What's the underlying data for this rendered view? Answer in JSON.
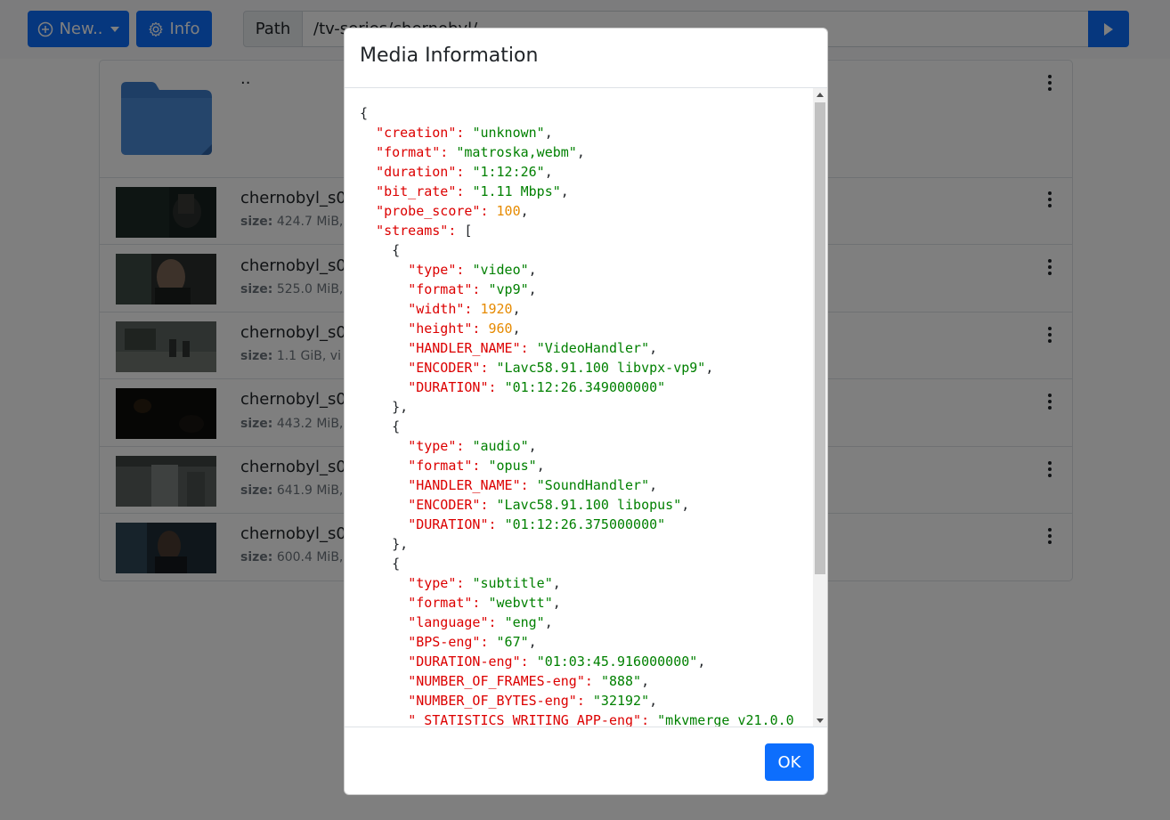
{
  "toolbar": {
    "new_label": "New..",
    "info_label": "Info",
    "path_label": "Path",
    "path_value": "/tv-series/chernobyl/"
  },
  "files": {
    "parent_label": "..",
    "items": [
      {
        "name": "chernobyl_s0",
        "size_label": "size:",
        "size_value": "424.7 MiB,"
      },
      {
        "name": "chernobyl_s0",
        "size_label": "size:",
        "size_value": "525.0 MiB,"
      },
      {
        "name": "chernobyl_s0",
        "size_label": "size:",
        "size_value": "1.1 GiB, vi"
      },
      {
        "name": "chernobyl_s0",
        "size_label": "size:",
        "size_value": "443.2 MiB,"
      },
      {
        "name": "chernobyl_s0",
        "size_label": "size:",
        "size_value": "641.9 MiB,"
      },
      {
        "name": "chernobyl_s0",
        "size_label": "size:",
        "size_value": "600.4 MiB,"
      }
    ]
  },
  "modal": {
    "title": "Media Information",
    "ok_label": "OK",
    "json_lines": [
      [
        {
          "t": "p",
          "v": "{"
        }
      ],
      [
        {
          "t": "p",
          "v": "  "
        },
        {
          "t": "k",
          "v": "\"creation\": "
        },
        {
          "t": "s",
          "v": "\"unknown\""
        },
        {
          "t": "p",
          "v": ","
        }
      ],
      [
        {
          "t": "p",
          "v": "  "
        },
        {
          "t": "k",
          "v": "\"format\": "
        },
        {
          "t": "s",
          "v": "\"matroska,webm\""
        },
        {
          "t": "p",
          "v": ","
        }
      ],
      [
        {
          "t": "p",
          "v": "  "
        },
        {
          "t": "k",
          "v": "\"duration\": "
        },
        {
          "t": "s",
          "v": "\"1:12:26\""
        },
        {
          "t": "p",
          "v": ","
        }
      ],
      [
        {
          "t": "p",
          "v": "  "
        },
        {
          "t": "k",
          "v": "\"bit_rate\": "
        },
        {
          "t": "s",
          "v": "\"1.11 Mbps\""
        },
        {
          "t": "p",
          "v": ","
        }
      ],
      [
        {
          "t": "p",
          "v": "  "
        },
        {
          "t": "k",
          "v": "\"probe_score\": "
        },
        {
          "t": "n",
          "v": "100"
        },
        {
          "t": "p",
          "v": ","
        }
      ],
      [
        {
          "t": "p",
          "v": "  "
        },
        {
          "t": "k",
          "v": "\"streams\": "
        },
        {
          "t": "p",
          "v": "["
        }
      ],
      [
        {
          "t": "p",
          "v": "    {"
        }
      ],
      [
        {
          "t": "p",
          "v": "      "
        },
        {
          "t": "k",
          "v": "\"type\": "
        },
        {
          "t": "s",
          "v": "\"video\""
        },
        {
          "t": "p",
          "v": ","
        }
      ],
      [
        {
          "t": "p",
          "v": "      "
        },
        {
          "t": "k",
          "v": "\"format\": "
        },
        {
          "t": "s",
          "v": "\"vp9\""
        },
        {
          "t": "p",
          "v": ","
        }
      ],
      [
        {
          "t": "p",
          "v": "      "
        },
        {
          "t": "k",
          "v": "\"width\": "
        },
        {
          "t": "n",
          "v": "1920"
        },
        {
          "t": "p",
          "v": ","
        }
      ],
      [
        {
          "t": "p",
          "v": "      "
        },
        {
          "t": "k",
          "v": "\"height\": "
        },
        {
          "t": "n",
          "v": "960"
        },
        {
          "t": "p",
          "v": ","
        }
      ],
      [
        {
          "t": "p",
          "v": "      "
        },
        {
          "t": "k",
          "v": "\"HANDLER_NAME\": "
        },
        {
          "t": "s",
          "v": "\"VideoHandler\""
        },
        {
          "t": "p",
          "v": ","
        }
      ],
      [
        {
          "t": "p",
          "v": "      "
        },
        {
          "t": "k",
          "v": "\"ENCODER\": "
        },
        {
          "t": "s",
          "v": "\"Lavc58.91.100 libvpx-vp9\""
        },
        {
          "t": "p",
          "v": ","
        }
      ],
      [
        {
          "t": "p",
          "v": "      "
        },
        {
          "t": "k",
          "v": "\"DURATION\": "
        },
        {
          "t": "s",
          "v": "\"01:12:26.349000000\""
        }
      ],
      [
        {
          "t": "p",
          "v": "    },"
        }
      ],
      [
        {
          "t": "p",
          "v": "    {"
        }
      ],
      [
        {
          "t": "p",
          "v": "      "
        },
        {
          "t": "k",
          "v": "\"type\": "
        },
        {
          "t": "s",
          "v": "\"audio\""
        },
        {
          "t": "p",
          "v": ","
        }
      ],
      [
        {
          "t": "p",
          "v": "      "
        },
        {
          "t": "k",
          "v": "\"format\": "
        },
        {
          "t": "s",
          "v": "\"opus\""
        },
        {
          "t": "p",
          "v": ","
        }
      ],
      [
        {
          "t": "p",
          "v": "      "
        },
        {
          "t": "k",
          "v": "\"HANDLER_NAME\": "
        },
        {
          "t": "s",
          "v": "\"SoundHandler\""
        },
        {
          "t": "p",
          "v": ","
        }
      ],
      [
        {
          "t": "p",
          "v": "      "
        },
        {
          "t": "k",
          "v": "\"ENCODER\": "
        },
        {
          "t": "s",
          "v": "\"Lavc58.91.100 libopus\""
        },
        {
          "t": "p",
          "v": ","
        }
      ],
      [
        {
          "t": "p",
          "v": "      "
        },
        {
          "t": "k",
          "v": "\"DURATION\": "
        },
        {
          "t": "s",
          "v": "\"01:12:26.375000000\""
        }
      ],
      [
        {
          "t": "p",
          "v": "    },"
        }
      ],
      [
        {
          "t": "p",
          "v": "    {"
        }
      ],
      [
        {
          "t": "p",
          "v": "      "
        },
        {
          "t": "k",
          "v": "\"type\": "
        },
        {
          "t": "s",
          "v": "\"subtitle\""
        },
        {
          "t": "p",
          "v": ","
        }
      ],
      [
        {
          "t": "p",
          "v": "      "
        },
        {
          "t": "k",
          "v": "\"format\": "
        },
        {
          "t": "s",
          "v": "\"webvtt\""
        },
        {
          "t": "p",
          "v": ","
        }
      ],
      [
        {
          "t": "p",
          "v": "      "
        },
        {
          "t": "k",
          "v": "\"language\": "
        },
        {
          "t": "s",
          "v": "\"eng\""
        },
        {
          "t": "p",
          "v": ","
        }
      ],
      [
        {
          "t": "p",
          "v": "      "
        },
        {
          "t": "k",
          "v": "\"BPS-eng\": "
        },
        {
          "t": "s",
          "v": "\"67\""
        },
        {
          "t": "p",
          "v": ","
        }
      ],
      [
        {
          "t": "p",
          "v": "      "
        },
        {
          "t": "k",
          "v": "\"DURATION-eng\": "
        },
        {
          "t": "s",
          "v": "\"01:03:45.916000000\""
        },
        {
          "t": "p",
          "v": ","
        }
      ],
      [
        {
          "t": "p",
          "v": "      "
        },
        {
          "t": "k",
          "v": "\"NUMBER_OF_FRAMES-eng\": "
        },
        {
          "t": "s",
          "v": "\"888\""
        },
        {
          "t": "p",
          "v": ","
        }
      ],
      [
        {
          "t": "p",
          "v": "      "
        },
        {
          "t": "k",
          "v": "\"NUMBER_OF_BYTES-eng\": "
        },
        {
          "t": "s",
          "v": "\"32192\""
        },
        {
          "t": "p",
          "v": ","
        }
      ],
      [
        {
          "t": "p",
          "v": "      "
        },
        {
          "t": "k",
          "v": "\"_STATISTICS_WRITING_APP-eng\": "
        },
        {
          "t": "s",
          "v": "\"mkvmerge v21.0.0"
        }
      ]
    ]
  },
  "icons": {
    "new": "plus-circle-icon",
    "info": "gear-icon",
    "go": "play-icon",
    "folder": "folder-icon",
    "more": "kebab-icon"
  },
  "colors": {
    "primary": "#0d6efd",
    "json_key": "#dc0000",
    "json_string": "#008000",
    "json_number": "#e68a00",
    "folder": "#3d7dca"
  }
}
